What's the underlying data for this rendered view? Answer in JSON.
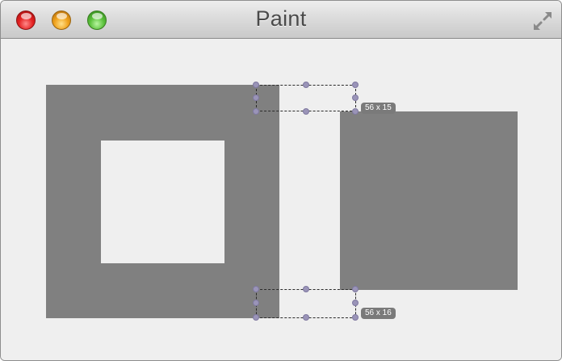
{
  "window": {
    "title": "Paint"
  },
  "icons": {
    "close": "close-icon",
    "minimize": "minimize-icon",
    "zoom": "zoom-icon",
    "fullscreen": "fullscreen-icon"
  },
  "colors": {
    "shape_fill": "#808080",
    "canvas_background": "#efefef",
    "handle": "#9a94b8",
    "size_label_background": "#7a7a7a",
    "close": "#e52222",
    "minimize": "#f0a21c",
    "zoom": "#5cc23c"
  },
  "selections": [
    {
      "size_label": "56 x 15"
    },
    {
      "size_label": "56 x 16"
    }
  ]
}
